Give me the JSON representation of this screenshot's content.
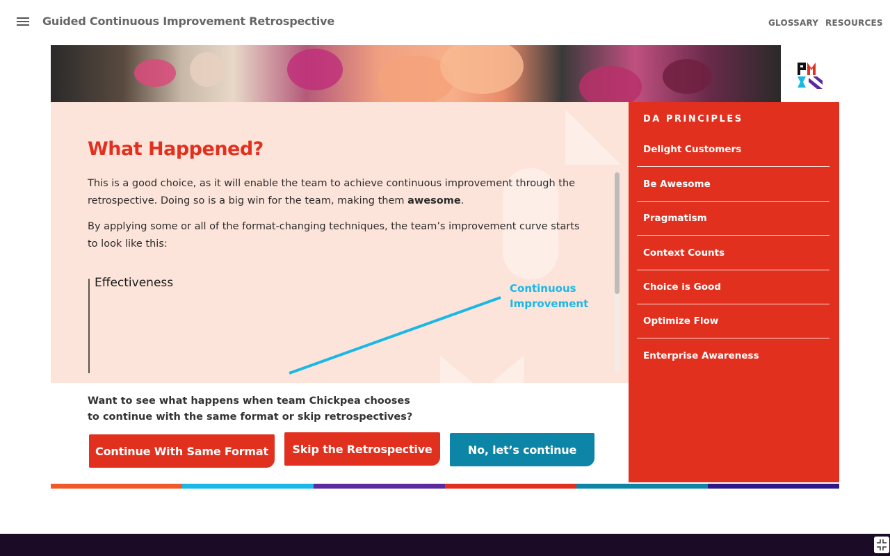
{
  "header": {
    "title": "Guided Continuous Improvement Retrospective",
    "links": [
      "GLOSSARY",
      "RESOURCES"
    ]
  },
  "content": {
    "heading": "What Happened?",
    "para1_a": "This is a good choice, as it will enable the team to achieve continuous improvement through the retrospective. Doing so is a big win for the team, making them ",
    "para1_bold": "awesome",
    "para1_end": ".",
    "para2": "By applying some or all of the format-changing techniques, the team’s improvement curve starts to look like this:",
    "chart": {
      "y_axis_label": "Effectiveness",
      "line_label_1": "Continuous",
      "line_label_2": "Improvement",
      "line_color": "#1ab8e6"
    }
  },
  "question": {
    "line1": "Want to see what happens when team Chickpea chooses",
    "line2": "to continue with the same format or skip retrospectives?"
  },
  "buttons": {
    "continue_same": "Continue With Same Format",
    "skip": "Skip the Retrospective",
    "no_continue": "No, let’s continue"
  },
  "principles": {
    "title": "DA PRINCIPLES",
    "items": [
      "Delight Customers",
      "Be Awesome",
      "Pragmatism",
      "Context Counts",
      "Choice is Good",
      "Optimize Flow",
      "Enterprise Awareness"
    ]
  },
  "colors": {
    "brand_red": "#e2301f",
    "teal": "#0c85a7",
    "panel_bg": "#fde4da",
    "footer_bg": "#1b0b26",
    "strip": [
      "#f05a28",
      "#1ab8e6",
      "#5b2a9e",
      "#e2301f",
      "#0c85a7",
      "#2c1a8a"
    ]
  },
  "icons": {
    "menu": "hamburger-icon",
    "logo": "pmi-logo",
    "fullscreen": "exit-fullscreen-icon"
  }
}
